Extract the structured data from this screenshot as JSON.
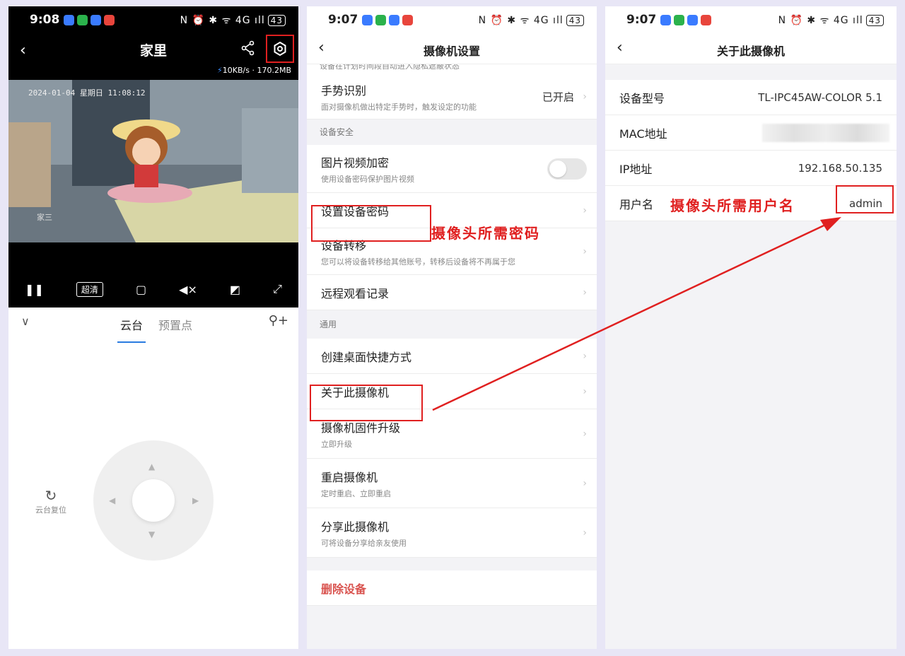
{
  "panel1": {
    "status": {
      "time": "9:08",
      "battery": "43",
      "icons_right": "N ⏰ ✱ ᯤ 4G ıll"
    },
    "header": {
      "title": "家里",
      "speed": "10KB/s · 170.2MB"
    },
    "video": {
      "timestamp": "2024-01-04 星期日 11:08:12",
      "watermark": "家三"
    },
    "controls": {
      "hd_label": "超清"
    },
    "ptz": {
      "tab_ptz": "云台",
      "tab_preset": "预置点",
      "reset_label": "云台复位"
    }
  },
  "panel2": {
    "status": {
      "time": "9:07",
      "battery": "43",
      "icons_right": "N ⏰ ✱ ᯤ 4G ıll"
    },
    "title": "摄像机设置",
    "cut_text": "设备在计划时间段自动进入隐私遮蔽状态",
    "gesture": {
      "label": "手势识别",
      "sub": "面对摄像机做出特定手势时，触发设定的功能",
      "value": "已开启"
    },
    "section_security": "设备安全",
    "encrypt": {
      "label": "图片视频加密",
      "sub": "使用设备密码保护图片视频"
    },
    "set_password": {
      "label": "设置设备密码"
    },
    "transfer": {
      "label": "设备转移",
      "sub": "您可以将设备转移给其他账号，转移后设备将不再属于您"
    },
    "remote_log": {
      "label": "远程观看记录"
    },
    "section_general": "通用",
    "shortcut": {
      "label": "创建桌面快捷方式"
    },
    "about": {
      "label": "关于此摄像机"
    },
    "firmware": {
      "label": "摄像机固件升级",
      "sub": "立即升级"
    },
    "reboot": {
      "label": "重启摄像机",
      "sub": "定时重启、立即重启"
    },
    "share": {
      "label": "分享此摄像机",
      "sub": "可将设备分享给亲友使用"
    },
    "delete": "删除设备",
    "annotation": "摄像头所需密码"
  },
  "panel3": {
    "status": {
      "time": "9:07",
      "battery": "43",
      "icons_right": "N ⏰ ✱ ᯤ 4G ıll"
    },
    "title": "关于此摄像机",
    "model": {
      "label": "设备型号",
      "value": "TL-IPC45AW-COLOR 5.1"
    },
    "mac": {
      "label": "MAC地址"
    },
    "ip": {
      "label": "IP地址",
      "value": "192.168.50.135"
    },
    "user": {
      "label": "用户名",
      "value": "admin"
    },
    "annotation": "摄像头所需用户名"
  },
  "colors": {
    "annotation_red": "#e02020",
    "accent_blue": "#2a7be0",
    "delete_red": "#d9534f"
  }
}
